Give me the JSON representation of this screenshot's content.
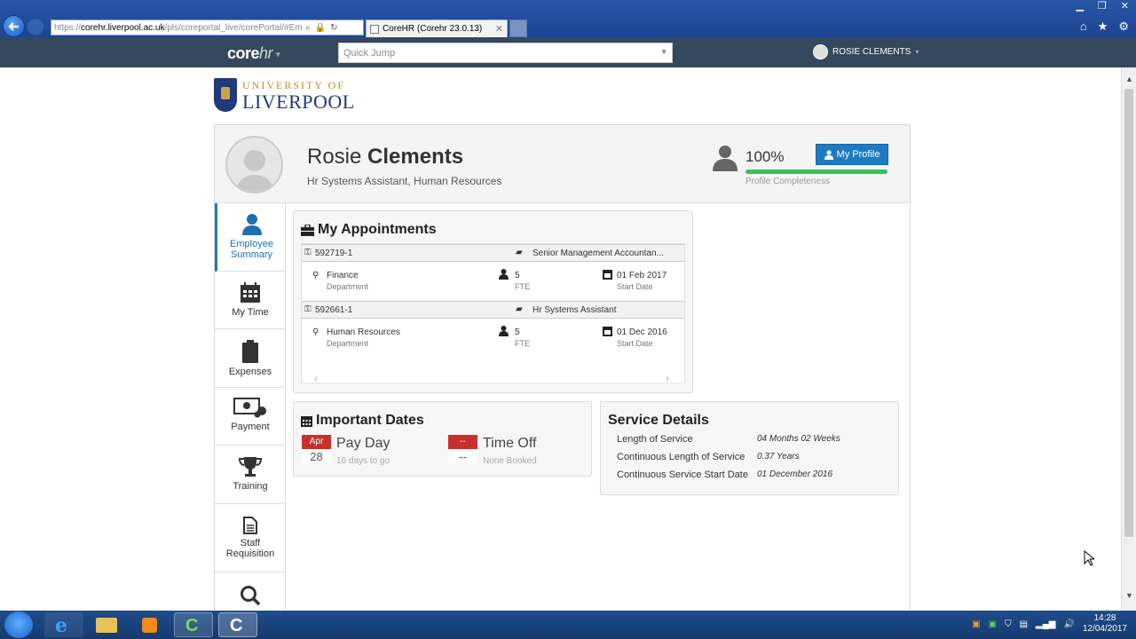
{
  "browser": {
    "url_prefix": "https://",
    "url_host": "corehr.liverpool.ac.uk",
    "url_rest": "/pls/coreportal_live/corePortal/#Em",
    "tab_title": "CoreHR (Corehr 23.0.13)"
  },
  "appbar": {
    "logo_main": "core",
    "logo_hr": "hr",
    "quickjump_placeholder": "Quick Jump",
    "user_name": "ROSIE CLEMENTS"
  },
  "university": {
    "line1": "UNIVERSITY OF",
    "line2": "LIVERPOOL"
  },
  "profile": {
    "first_name": "Rosie",
    "last_name": "Clements",
    "subtitle": "Hr Systems Assistant, Human Resources",
    "completeness_value": "100%",
    "completeness_fraction": 1.0,
    "completeness_label": "Profile Completeness",
    "my_profile_label": "My Profile"
  },
  "nav": [
    {
      "label": "Employee Summary",
      "icon": "person-icon"
    },
    {
      "label": "My Time",
      "icon": "calendar-icon"
    },
    {
      "label": "Expenses",
      "icon": "clipboard-icon"
    },
    {
      "label": "Payment",
      "icon": "money-icon"
    },
    {
      "label": "Training",
      "icon": "trophy-icon"
    },
    {
      "label": "Staff Requisition",
      "icon": "document-icon"
    },
    {
      "label": "",
      "icon": "search-icon"
    }
  ],
  "appointments": {
    "title": "My Appointments",
    "items": [
      {
        "id": "592719-1",
        "role": "Senior Management Accountan...",
        "department": "Finance",
        "department_label": "Department",
        "fte": "5",
        "fte_label": "FTE",
        "start_date": "01 Feb 2017",
        "start_label": "Start Date"
      },
      {
        "id": "592661-1",
        "role": "Hr Systems Assistant",
        "department": "Human Resources",
        "department_label": "Department",
        "fte": "5",
        "fte_label": "FTE",
        "start_date": "01 Dec 2016",
        "start_label": "Start Date"
      }
    ]
  },
  "important_dates": {
    "title": "Important Dates",
    "payday": {
      "month": "Apr",
      "day": "28",
      "label": "Pay Day",
      "note": "16 days to go"
    },
    "timeoff": {
      "month": "--",
      "day": "--",
      "label": "Time Off",
      "note": "None Booked"
    }
  },
  "service": {
    "title": "Service Details",
    "rows": [
      {
        "label": "Length of Service",
        "value": "04  Months 02  Weeks"
      },
      {
        "label": "Continuous Length of Service",
        "value": "0.37  Years"
      },
      {
        "label": "Continuous Service Start Date",
        "value": "01 December 2016"
      }
    ]
  },
  "taskbar": {
    "time": "14:28",
    "date": "12/04/2017"
  },
  "colors": {
    "appbar": "#34495e",
    "accent": "#1e7bc2",
    "progress": "#3ac05a",
    "calendar_red": "#c9302c"
  }
}
